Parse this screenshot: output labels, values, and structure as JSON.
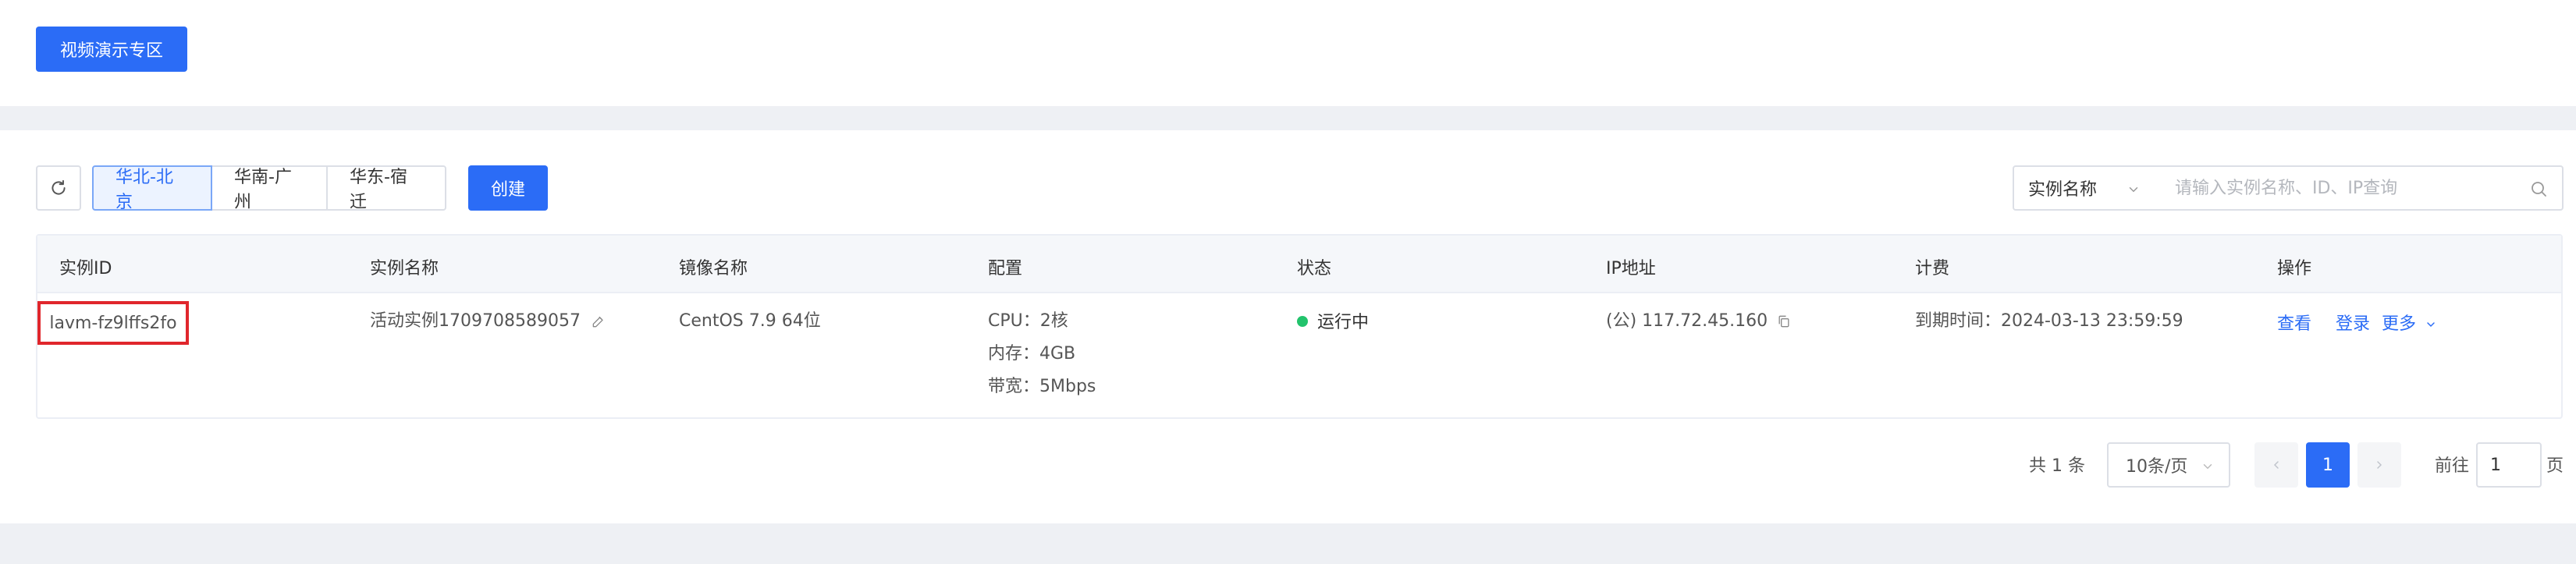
{
  "top": {
    "demo_button": "视频演示专区"
  },
  "toolbar": {
    "refresh_icon": "refresh-icon",
    "region_tabs": [
      {
        "label": "华北-北京",
        "active": true
      },
      {
        "label": "华南-广州",
        "active": false
      },
      {
        "label": "华东-宿迁",
        "active": false
      }
    ],
    "create_button": "创建",
    "search_field_select": "实例名称",
    "search_placeholder": "请输入实例名称、ID、IP查询",
    "search_value": ""
  },
  "table": {
    "columns": [
      "实例ID",
      "实例名称",
      "镜像名称",
      "配置",
      "状态",
      "IP地址",
      "计费",
      "操作"
    ],
    "rows": [
      {
        "instance_id": "lavm-fz9lffs2fo",
        "instance_name": "活动实例1709708589057",
        "image_name": "CentOS 7.9 64位",
        "config_cpu": "CPU：2核",
        "config_mem": "内存：4GB",
        "config_bw": "带宽：5Mbps",
        "status": "运行中",
        "status_color": "#22c36c",
        "ip": "(公) 117.72.45.160",
        "billing": "到期时间：2024-03-13 23:59:59",
        "actions": {
          "view": "查看",
          "login": "登录",
          "more": "更多"
        }
      }
    ]
  },
  "pagination": {
    "total": "共 1 条",
    "page_size": "10条/页",
    "current_page": "1",
    "goto_label": "前往",
    "goto_value": "1",
    "goto_suffix": "页"
  },
  "colors": {
    "primary": "#2b6cf6",
    "highlight_box": "#e0262c",
    "status_running": "#22c36c"
  }
}
